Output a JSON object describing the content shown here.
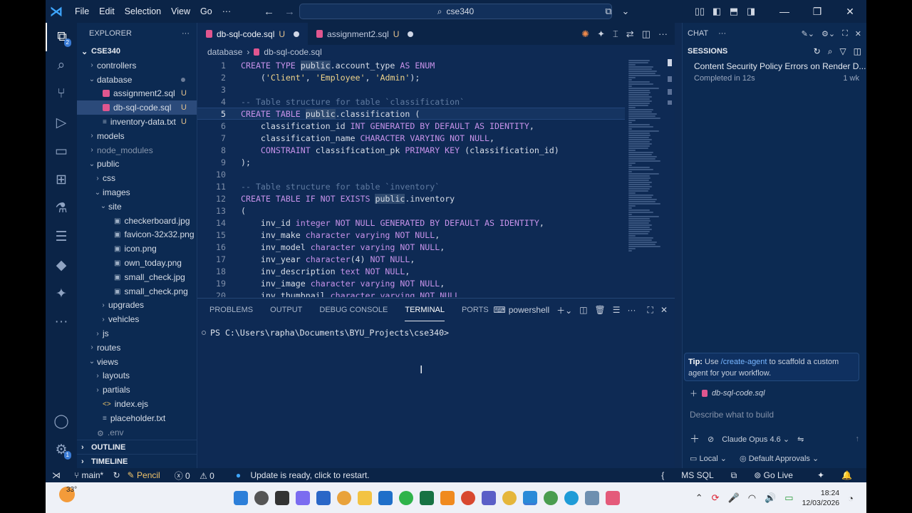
{
  "titlebar": {
    "menu": [
      "File",
      "Edit",
      "Selection",
      "View",
      "Go",
      "···"
    ],
    "search_text": "cse340"
  },
  "activity": {
    "explorer_badge": "2",
    "settings_badge": "1"
  },
  "sidebar": {
    "title": "EXPLORER",
    "root": "CSE340",
    "items": [
      {
        "label": "controllers",
        "depth": 1,
        "kind": "folder",
        "open": false
      },
      {
        "label": "database",
        "depth": 1,
        "kind": "folder",
        "open": true,
        "dot": true
      },
      {
        "label": "assignment2.sql",
        "depth": 2,
        "kind": "sql",
        "status": "U"
      },
      {
        "label": "db-sql-code.sql",
        "depth": 2,
        "kind": "sql",
        "status": "U",
        "selected": true
      },
      {
        "label": "inventory-data.txt",
        "depth": 2,
        "kind": "txt",
        "status": "U"
      },
      {
        "label": "models",
        "depth": 1,
        "kind": "folder",
        "open": false
      },
      {
        "label": "node_modules",
        "depth": 1,
        "kind": "folder",
        "open": false,
        "dim": true
      },
      {
        "label": "public",
        "depth": 1,
        "kind": "folder",
        "open": true
      },
      {
        "label": "css",
        "depth": 2,
        "kind": "folder",
        "open": false
      },
      {
        "label": "images",
        "depth": 2,
        "kind": "folder",
        "open": true
      },
      {
        "label": "site",
        "depth": 3,
        "kind": "folder",
        "open": true
      },
      {
        "label": "checkerboard.jpg",
        "depth": 4,
        "kind": "img"
      },
      {
        "label": "favicon-32x32.png",
        "depth": 4,
        "kind": "img"
      },
      {
        "label": "icon.png",
        "depth": 4,
        "kind": "img"
      },
      {
        "label": "own_today.png",
        "depth": 4,
        "kind": "img"
      },
      {
        "label": "small_check.jpg",
        "depth": 4,
        "kind": "img"
      },
      {
        "label": "small_check.png",
        "depth": 4,
        "kind": "img"
      },
      {
        "label": "upgrades",
        "depth": 3,
        "kind": "folder",
        "open": false
      },
      {
        "label": "vehicles",
        "depth": 3,
        "kind": "folder",
        "open": false
      },
      {
        "label": "js",
        "depth": 2,
        "kind": "folder",
        "open": false
      },
      {
        "label": "routes",
        "depth": 1,
        "kind": "folder",
        "open": false
      },
      {
        "label": "views",
        "depth": 1,
        "kind": "folder",
        "open": true
      },
      {
        "label": "layouts",
        "depth": 2,
        "kind": "folder",
        "open": false
      },
      {
        "label": "partials",
        "depth": 2,
        "kind": "folder",
        "open": false
      },
      {
        "label": "index.ejs",
        "depth": 2,
        "kind": "ejs"
      },
      {
        "label": "placeholder.txt",
        "depth": 2,
        "kind": "txt"
      },
      {
        "label": ".env",
        "depth": 1,
        "kind": "env",
        "dim": true
      }
    ],
    "outline": "OUTLINE",
    "timeline": "TIMELINE"
  },
  "editor": {
    "tabs": [
      {
        "label": "db-sql-code.sql",
        "status": "U",
        "active": true
      },
      {
        "label": "assignment2.sql",
        "status": "U",
        "active": false
      }
    ],
    "breadcrumb": [
      "database",
      "db-sql-code.sql"
    ],
    "current_line": 5,
    "lines": [
      [
        [
          "kw",
          "CREATE TYPE "
        ],
        [
          "hl",
          "public"
        ],
        [
          "id",
          ".account_type "
        ],
        [
          "kw",
          "AS ENUM"
        ]
      ],
      [
        [
          "id",
          "    ("
        ],
        [
          "str",
          "'Client'"
        ],
        [
          "id",
          ", "
        ],
        [
          "str",
          "'Employee'"
        ],
        [
          "id",
          ", "
        ],
        [
          "str",
          "'Admin'"
        ],
        [
          "id",
          ");"
        ]
      ],
      [],
      [
        [
          "cm",
          "-- Table structure for table `classification`"
        ]
      ],
      [
        [
          "kw",
          "CREATE TABLE "
        ],
        [
          "hl",
          "public"
        ],
        [
          "id",
          ".classification ("
        ]
      ],
      [
        [
          "id",
          "    classification_id "
        ],
        [
          "kw",
          "INT GENERATED BY DEFAULT AS IDENTITY"
        ],
        [
          "id",
          ","
        ]
      ],
      [
        [
          "id",
          "    classification_name "
        ],
        [
          "kw",
          "CHARACTER VARYING NOT NULL"
        ],
        [
          "id",
          ","
        ]
      ],
      [
        [
          "id",
          "    "
        ],
        [
          "kw",
          "CONSTRAINT "
        ],
        [
          "id",
          "classification_pk "
        ],
        [
          "kw",
          "PRIMARY KEY "
        ],
        [
          "id",
          "(classification_id)"
        ]
      ],
      [
        [
          "id",
          ");"
        ]
      ],
      [],
      [
        [
          "cm",
          "-- Table structure for table `inventory`"
        ]
      ],
      [
        [
          "kw",
          "CREATE TABLE IF NOT EXISTS "
        ],
        [
          "hl",
          "public"
        ],
        [
          "id",
          ".inventory"
        ]
      ],
      [
        [
          "id",
          "("
        ]
      ],
      [
        [
          "id",
          "    inv_id "
        ],
        [
          "kw",
          "integer NOT NULL GENERATED BY DEFAULT AS IDENTITY"
        ],
        [
          "id",
          ","
        ]
      ],
      [
        [
          "id",
          "    inv_make "
        ],
        [
          "kw",
          "character varying NOT NULL"
        ],
        [
          "id",
          ","
        ]
      ],
      [
        [
          "id",
          "    inv_model "
        ],
        [
          "kw",
          "character varying NOT NULL"
        ],
        [
          "id",
          ","
        ]
      ],
      [
        [
          "id",
          "    inv_year "
        ],
        [
          "kw",
          "character"
        ],
        [
          "id",
          "(4) "
        ],
        [
          "kw",
          "NOT NULL"
        ],
        [
          "id",
          ","
        ]
      ],
      [
        [
          "id",
          "    inv_description "
        ],
        [
          "kw",
          "text NOT NULL"
        ],
        [
          "id",
          ","
        ]
      ],
      [
        [
          "id",
          "    inv_image "
        ],
        [
          "kw",
          "character varying NOT NULL"
        ],
        [
          "id",
          ","
        ]
      ],
      [
        [
          "id",
          "    inv_thumbnail "
        ],
        [
          "kw",
          "character varying NOT NULL"
        ]
      ]
    ]
  },
  "panel": {
    "tabs": [
      "PROBLEMS",
      "OUTPUT",
      "DEBUG CONSOLE",
      "TERMINAL",
      "PORTS"
    ],
    "active_tab": "TERMINAL",
    "shell": "powershell",
    "prompt": "PS C:\\Users\\rapha\\Documents\\BYU_Projects\\cse340>"
  },
  "chat": {
    "title": "CHAT",
    "sessions_label": "SESSIONS",
    "session": {
      "title": "Content Security Policy Errors on Render D...",
      "sub": "Completed in 12s",
      "age": "1 wk"
    },
    "tip_bold": "Tip:",
    "tip_pre": " Use ",
    "tip_link": "/create-agent",
    "tip_post": " to scaffold a custom agent for your workflow.",
    "context_file": "db-sql-code.sql",
    "input_placeholder": "Describe what to build",
    "model": "Claude Opus 4.6",
    "mode": "Local",
    "approvals": "Default Approvals"
  },
  "status": {
    "branch": "main*",
    "pencil": "Pencil",
    "errors": "0",
    "warnings": "0",
    "update": "Update is ready, click to restart.",
    "lang": "MS SQL",
    "golive": "Go Live"
  },
  "taskbar": {
    "temp": "33°",
    "time": "18:24",
    "date": "12/03/2026"
  },
  "colors": {
    "accent": "#3ea6ff",
    "background": "#0f2a52",
    "keyword": "#c792ea",
    "string": "#f0d48a",
    "untracked": "#e1c08d"
  }
}
